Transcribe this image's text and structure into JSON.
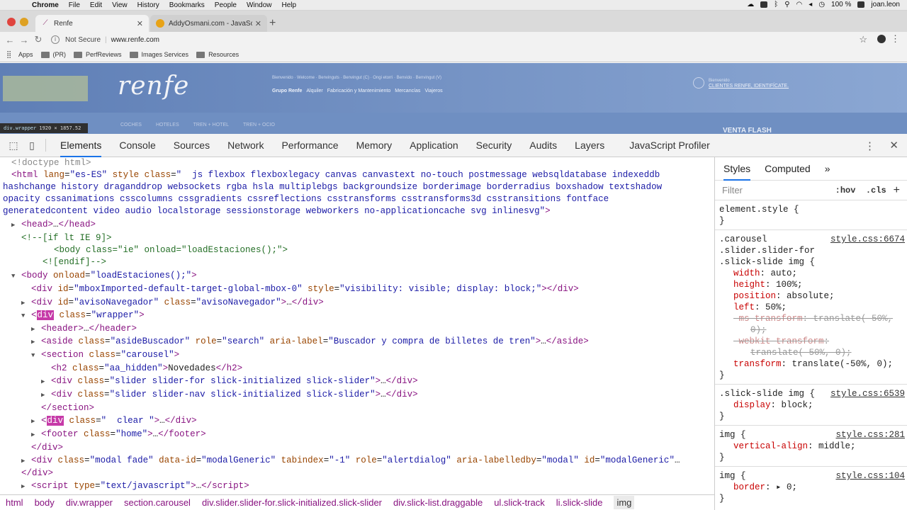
{
  "menubar": {
    "app": "Chrome",
    "items": [
      "File",
      "Edit",
      "View",
      "History",
      "Bookmarks",
      "People",
      "Window",
      "Help"
    ],
    "battery": "100 %",
    "user": "joan.leon"
  },
  "tabs": [
    {
      "title": "Renfe",
      "active": true
    },
    {
      "title": "AddyOsmani.com - JavaScript",
      "active": false
    }
  ],
  "address": {
    "security": "Not Secure",
    "url": "www.renfe.com"
  },
  "bookmarks": [
    "Apps",
    "(PR)",
    "PerfReviews",
    "Images Services",
    "Resources"
  ],
  "page": {
    "logo": "renfe",
    "welcome": "Bienvenido · Welcome · Benvinguts · Benvingut (C) · Ongi etorri · Benvido · Benvingut (V)",
    "group_links": [
      "Grupo Renfe",
      "Alquiler",
      "Fabricación y Mantenimiento",
      "Mercancías",
      "Viajeros"
    ],
    "client_small": "Bienvenido",
    "client_link": "CLIENTES RENFE, IDENTIFÍCATE.",
    "subnav": [
      "COCHES",
      "HOTELES",
      "TREN + HOTEL",
      "TREN + OCIO"
    ],
    "flash": "VENTA FLASH",
    "hover_badge": {
      "name": "div.wrapper",
      "size": "1920 × 1857.52"
    }
  },
  "devtools": {
    "tabs": [
      "Elements",
      "Console",
      "Sources",
      "Network",
      "Performance",
      "Memory",
      "Application",
      "Security",
      "Audits",
      "Layers",
      "JavaScript Profiler"
    ],
    "active_tab": "Elements",
    "breadcrumbs": [
      "html",
      "body",
      "div.wrapper",
      "section.carousel",
      "div.slider.slider-for.slick-initialized.slick-slider",
      "div.slick-list.draggable",
      "ul.slick-track",
      "li.slick-slide",
      "img"
    ],
    "styles": {
      "tabs": [
        "Styles",
        "Computed"
      ],
      "filter_placeholder": "Filter",
      "hov": ":hov",
      "cls": ".cls",
      "element_style": "element.style {",
      "rules": [
        {
          "selector": [
            ".carousel",
            ".slider.slider-for",
            ".slick-slide img {"
          ],
          "source": "style.css:6674"
        },
        {
          "selector": [
            ".slick-slide img {"
          ],
          "source": "style.css:6539"
        },
        {
          "selector": [
            "img {"
          ],
          "source": "style.css:281"
        },
        {
          "selector": [
            "img {"
          ],
          "source": "style.css:104"
        }
      ]
    }
  }
}
